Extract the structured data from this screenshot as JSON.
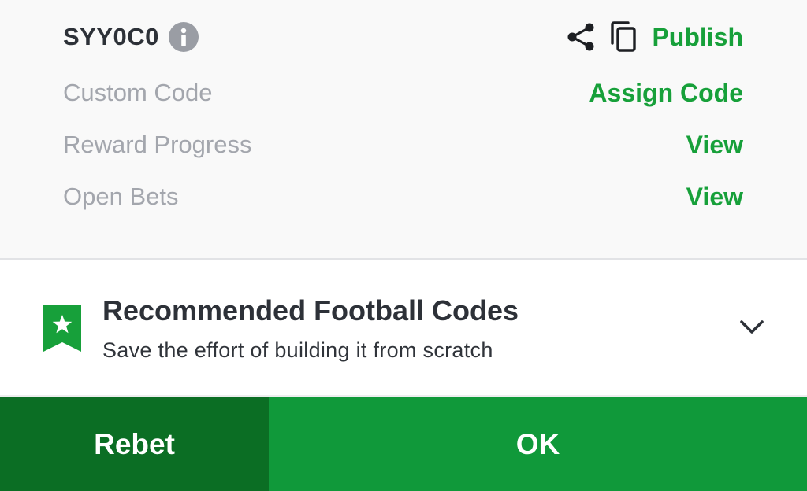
{
  "header": {
    "code": "SYY0C0",
    "publish_label": "Publish",
    "icons": [
      "info-icon",
      "share-icon",
      "copy-icon"
    ]
  },
  "rows": {
    "custom_code": {
      "label": "Custom Code",
      "action": "Assign Code"
    },
    "reward_progress": {
      "label": "Reward Progress",
      "action": "View"
    },
    "open_bets": {
      "label": "Open Bets",
      "action": "View"
    }
  },
  "recommended": {
    "title": "Recommended Football Codes",
    "subtitle": "Save the effort of building it from scratch",
    "icons": [
      "star-bookmark-icon",
      "chevron-down-icon"
    ]
  },
  "footer": {
    "rebet_label": "Rebet",
    "ok_label": "OK"
  },
  "colors": {
    "accent_green": "#17a03a",
    "ok_button": "#10993a",
    "rebet_button": "#0b6e24",
    "label_gray": "#a3a6ad",
    "text_dark": "#2d3138"
  }
}
